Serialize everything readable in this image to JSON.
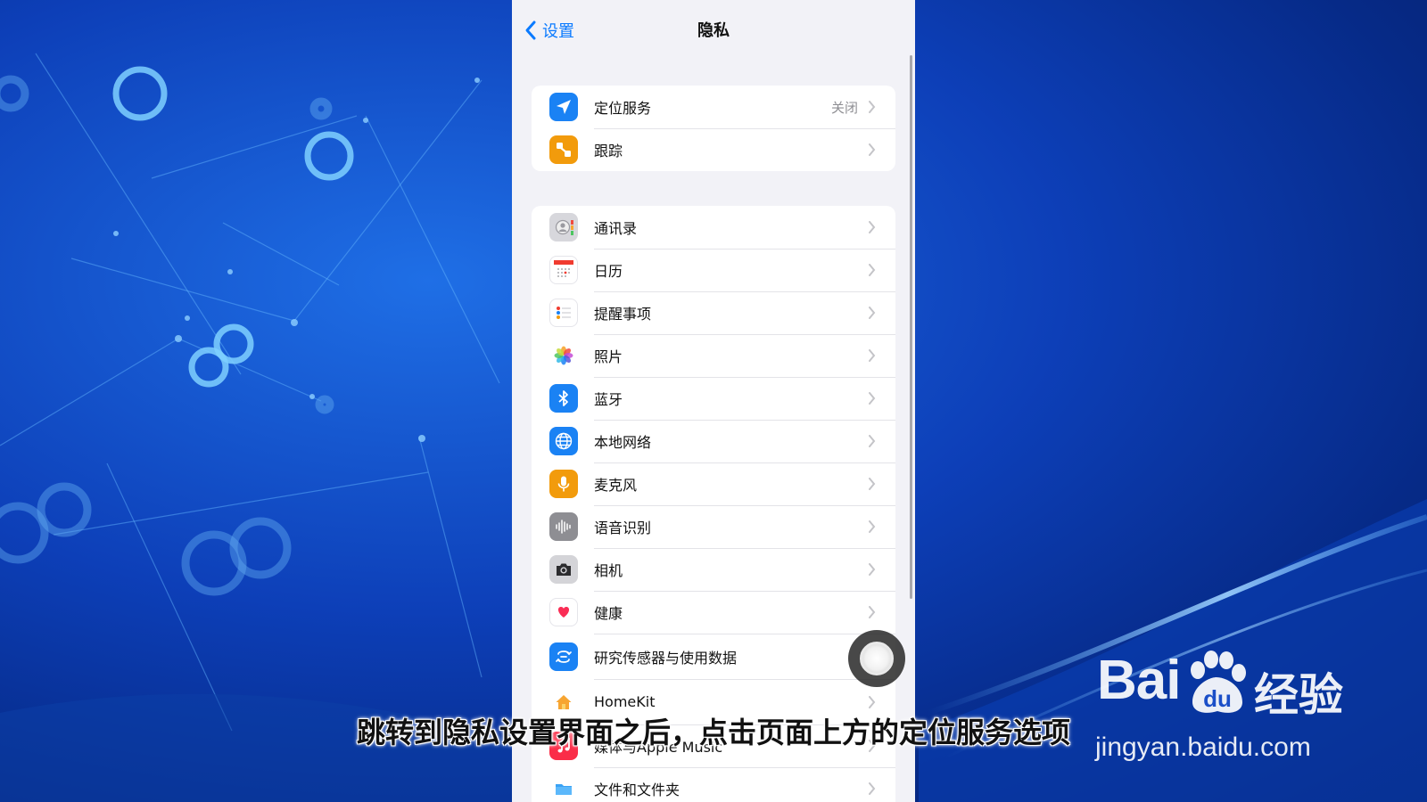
{
  "nav": {
    "back_label": "设置",
    "title": "隐私"
  },
  "group1": [
    {
      "label": "定位服务",
      "value": "关闭",
      "icon": "location-arrow-icon",
      "color": "#1a82f4"
    },
    {
      "label": "跟踪",
      "value": "",
      "icon": "tracking-icon",
      "color": "#f29b0c"
    }
  ],
  "group2": [
    {
      "label": "通讯录",
      "icon": "contacts-icon",
      "color": "#d7d7dc"
    },
    {
      "label": "日历",
      "icon": "calendar-icon",
      "color": "#ffffff"
    },
    {
      "label": "提醒事项",
      "icon": "reminders-icon",
      "color": "#ffffff"
    },
    {
      "label": "照片",
      "icon": "photos-icon",
      "color": "#ffffff"
    },
    {
      "label": "蓝牙",
      "icon": "bluetooth-icon",
      "color": "#1a82f4"
    },
    {
      "label": "本地网络",
      "icon": "globe-icon",
      "color": "#1a82f4"
    },
    {
      "label": "麦克风",
      "icon": "microphone-icon",
      "color": "#f29b0c"
    },
    {
      "label": "语音识别",
      "icon": "waveform-icon",
      "color": "#8e8e93"
    },
    {
      "label": "相机",
      "icon": "camera-icon",
      "color": "#d4d4d8"
    },
    {
      "label": "健康",
      "icon": "heart-icon",
      "color": "#ffffff"
    },
    {
      "label": "研究传感器与使用数据",
      "icon": "research-icon",
      "color": "#1a82f4"
    },
    {
      "label": "HomeKit",
      "icon": "home-icon",
      "color": "#ffffff"
    },
    {
      "label": "媒体与Apple Music",
      "icon": "music-note-icon",
      "color": "#fa2d48"
    },
    {
      "label": "文件和文件夹",
      "icon": "folder-icon",
      "color": "#ffffff"
    }
  ],
  "caption": "跳转到隐私设置界面之后，点击页面上方的定位服务选项",
  "watermark": {
    "brand": "Bai",
    "paw_text": "du",
    "suffix": "经验",
    "url": "jingyan.baidu.com"
  }
}
